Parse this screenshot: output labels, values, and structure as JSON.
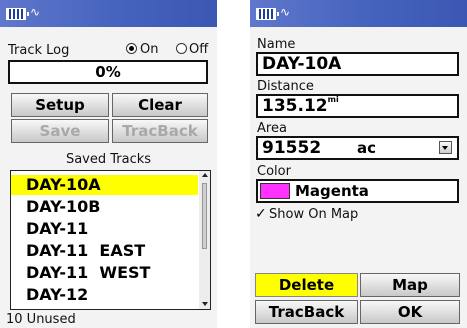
{
  "left": {
    "status": {
      "satellite_glyph": "∿"
    },
    "track_log": {
      "label": "Track Log",
      "on_label": "On",
      "off_label": "Off",
      "selected": "On",
      "percent": "0%"
    },
    "buttons": {
      "setup": "Setup",
      "clear": "Clear",
      "save": "Save",
      "trackback": "TracBack"
    },
    "saved_tracks": {
      "title": "Saved Tracks",
      "items": [
        "DAY-10A",
        "DAY-10B",
        "DAY-11",
        "DAY-11  EAST",
        "DAY-11  WEST",
        "DAY-12"
      ],
      "selected_index": 0
    },
    "footer": "10 Unused"
  },
  "right": {
    "status": {
      "satellite_glyph": "∿"
    },
    "name": {
      "label": "Name",
      "value": "DAY-10A"
    },
    "distance": {
      "label": "Distance",
      "value": "135.12",
      "unit": "mi"
    },
    "area": {
      "label": "Area",
      "value": "91552",
      "unit": "ac"
    },
    "color": {
      "label": "Color",
      "value": "Magenta",
      "swatch": "#ff33ff"
    },
    "show_on_map": {
      "label": "Show On Map",
      "checked": true,
      "check_glyph": "✓"
    },
    "buttons": {
      "delete": "Delete",
      "map": "Map",
      "trackback": "TracBack",
      "ok": "OK"
    }
  },
  "colors": {
    "titlebar": "#4563bd",
    "highlight": "#ffff00",
    "screen_bg": "#f3f3f3"
  }
}
